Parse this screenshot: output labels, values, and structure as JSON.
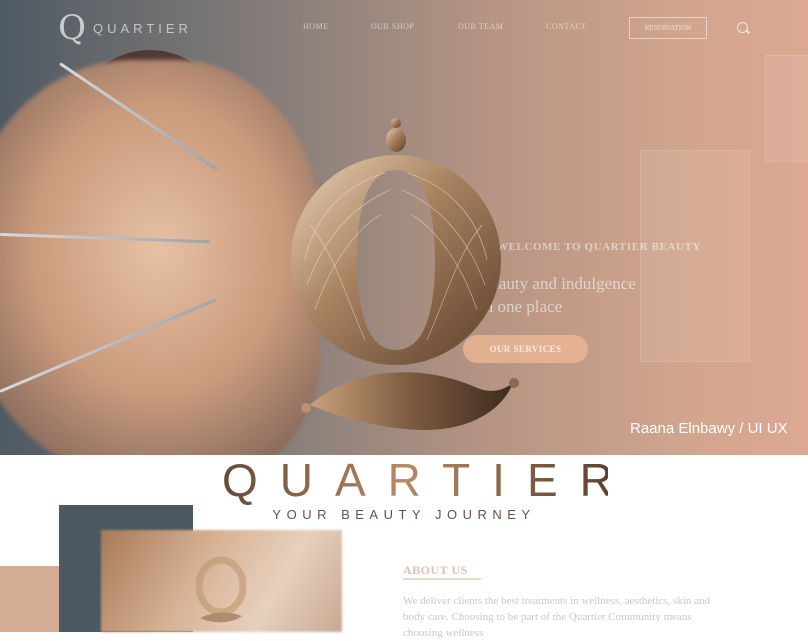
{
  "brand": {
    "logo_letter": "Q",
    "name": "QUARTIER",
    "tagline": "YOUR BEAUTY JOURNEY"
  },
  "nav": {
    "items": [
      "HOME",
      "OUR SHOP",
      "OUR TEAM",
      "CONTACT"
    ],
    "reservation": "RESERVATION"
  },
  "hero": {
    "welcome": "WELCOME TO QUARTIER BEAUTY",
    "headline_line1": "Beauty and indulgence",
    "headline_line2": "in one place",
    "cta": "OUR SERVICES",
    "credit": "Raana Elnbawy / UI UX"
  },
  "about": {
    "title": "ABOUT US",
    "text": "We deliver clients the best treatments in wellness, aesthetics, skin and body care. Choosing to be part of the Quartier Community means choosing wellness"
  },
  "colors": {
    "accent": "#b68b64",
    "dark_brown": "#5b4231",
    "slate": "#4b5963",
    "peach": "#d4ab93"
  }
}
